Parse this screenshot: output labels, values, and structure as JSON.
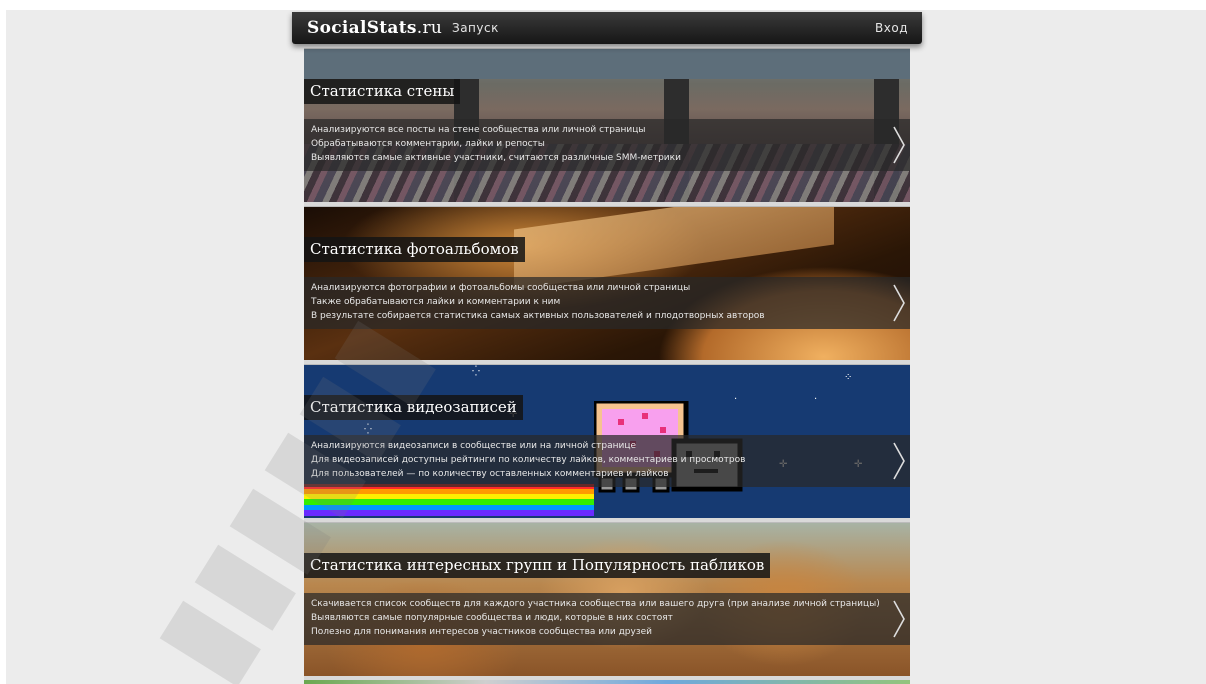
{
  "header": {
    "logo_bold": "SocialStats",
    "logo_suffix": ".ru",
    "nav_launch": "Запуск",
    "nav_login": "Вход"
  },
  "cards": [
    {
      "title": "Статистика стены",
      "lines": [
        "Анализируются все посты на стене сообщества или личной страницы",
        "Обрабатываются комментарии, лайки и репосты",
        "Выявляются самые активные участники, считаются различные SMM-метрики"
      ]
    },
    {
      "title": "Статистика фотоальбомов",
      "lines": [
        "Анализируются фотографии и фотоальбомы сообщества или личной страницы",
        "Также обрабатываются лайки и комментарии к ним",
        "В результате собирается статистика самых активных пользователей и плодотворных авторов"
      ]
    },
    {
      "title": "Статистика видеозаписей",
      "lines": [
        "Анализируются видеозаписи в сообществе или на личной странице",
        "Для видеозаписей доступны рейтинги по количеству лайков, комментариев и просмотров",
        "Для пользователей — по количеству оставленных комментариев и лайков"
      ]
    },
    {
      "title": "Статистика интересных групп и Популярность пабликов",
      "lines": [
        "Скачивается список сообществ для каждого участника сообщества или вашего друга (при анализе личной страницы)",
        "Выявляются самые популярные сообщества и люди, которые в них состоят",
        "Полезно для понимания интересов участников сообщества или друзей"
      ]
    }
  ],
  "icons": {
    "card_arrow": "chevron-right-icon"
  },
  "colors": {
    "header_bg": "#1e1e1e",
    "page_bg": "#ececec",
    "band_bg": "#282828"
  }
}
